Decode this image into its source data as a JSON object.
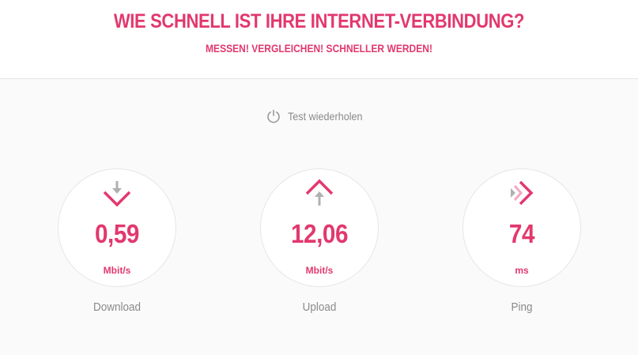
{
  "header": {
    "title": "WIE SCHNELL IST IHRE INTERNET-VERBINDUNG?",
    "subtitle": "MESSEN! VERGLEICHEN! SCHNELLER WERDEN!"
  },
  "actions": {
    "repeat_test_label": "Test wiederholen",
    "repeat_test_icon": "power-icon"
  },
  "metrics": [
    {
      "value": "0,59",
      "unit": "Mbit/s",
      "label": "Download",
      "icon": "download-arrow-icon"
    },
    {
      "value": "12,06",
      "unit": "Mbit/s",
      "label": "Upload",
      "icon": "upload-arrow-icon"
    },
    {
      "value": "74",
      "unit": "ms",
      "label": "Ping",
      "icon": "ping-arrow-icon"
    }
  ],
  "colors": {
    "accent": "#e2386e",
    "accent_light": "#f3a8c3",
    "gray_text": "#8a8a8a",
    "gray_icon": "#b0b0b0",
    "background": "#fafafa"
  }
}
